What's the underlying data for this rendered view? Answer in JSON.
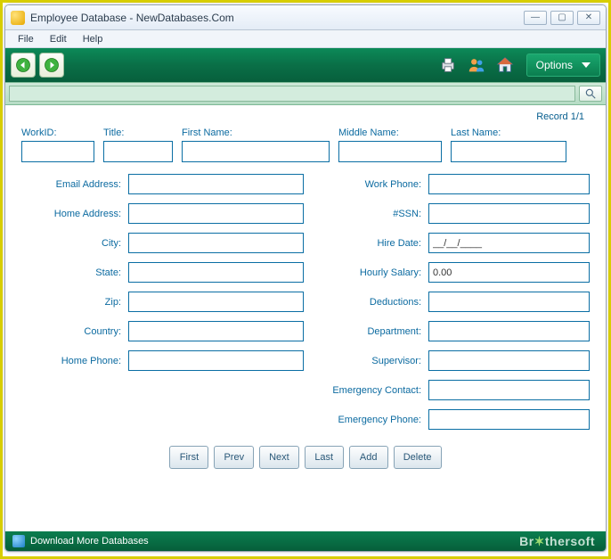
{
  "window": {
    "title": "Employee Database - NewDatabases.Com"
  },
  "menu": {
    "file": "File",
    "edit": "Edit",
    "help": "Help"
  },
  "toolbar": {
    "options": "Options"
  },
  "record_status": "Record 1/1",
  "top": {
    "workid": {
      "label": "WorkID:",
      "value": ""
    },
    "title": {
      "label": "Title:",
      "value": ""
    },
    "fname": {
      "label": "First Name:",
      "value": ""
    },
    "mname": {
      "label": "Middle Name:",
      "value": ""
    },
    "lname": {
      "label": "Last Name:",
      "value": ""
    }
  },
  "left": {
    "email": {
      "label": "Email Address:",
      "value": ""
    },
    "haddr": {
      "label": "Home Address:",
      "value": ""
    },
    "city": {
      "label": "City:",
      "value": ""
    },
    "state": {
      "label": "State:",
      "value": ""
    },
    "zip": {
      "label": "Zip:",
      "value": ""
    },
    "country": {
      "label": "Country:",
      "value": ""
    },
    "hphone": {
      "label": "Home Phone:",
      "value": ""
    }
  },
  "right": {
    "wphone": {
      "label": "Work Phone:",
      "value": ""
    },
    "ssn": {
      "label": "#SSN:",
      "value": ""
    },
    "hdate": {
      "label": "Hire Date:",
      "value": "__/__/____"
    },
    "salary": {
      "label": "Hourly Salary:",
      "value": "0.00"
    },
    "deduct": {
      "label": "Deductions:",
      "value": ""
    },
    "dept": {
      "label": "Department:",
      "value": ""
    },
    "superv": {
      "label": "Supervisor:",
      "value": ""
    },
    "econtact": {
      "label": "Emergency Contact:",
      "value": ""
    },
    "ephone": {
      "label": "Emergency Phone:",
      "value": ""
    }
  },
  "buttons": {
    "first": "First",
    "prev": "Prev",
    "next": "Next",
    "last": "Last",
    "add": "Add",
    "delete": "Delete"
  },
  "status": {
    "download": "Download More Databases"
  },
  "watermark": {
    "a": "Br",
    "b": "thersoft"
  }
}
